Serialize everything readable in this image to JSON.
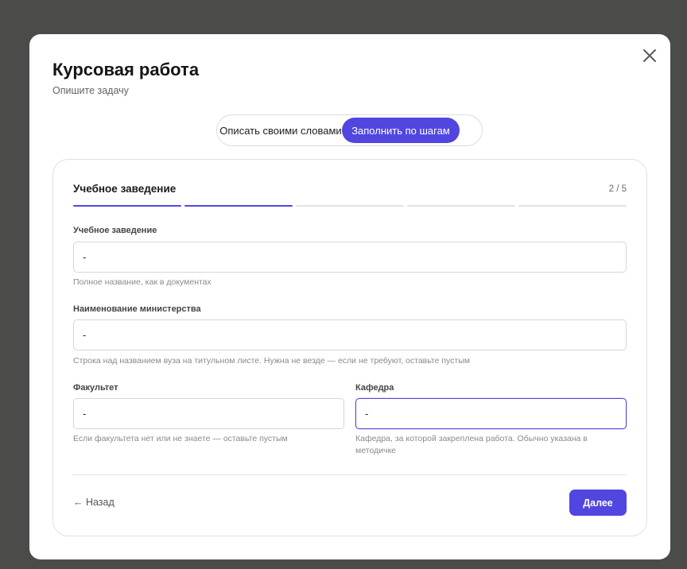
{
  "modal": {
    "title": "Курсовая работа",
    "subtitle": "Опишите задачу",
    "close_icon": "close-icon"
  },
  "mode_switch": {
    "options": [
      "Описать своими словами",
      "Заполнить по шагам"
    ],
    "selected": "Заполнить по шагам"
  },
  "step": {
    "title": "Учебное заведение",
    "counter": "2 / 5",
    "current": 2,
    "total": 5
  },
  "fields": {
    "institution": {
      "label": "Учебное заведение",
      "value": "-",
      "hint": "Полное название, как в документах"
    },
    "ministry": {
      "label": "Наименование министерства",
      "value": "-",
      "hint": "Строка над названием вуза на титульном листе. Нужна не везде — если не требуют, оставьте пустым"
    },
    "faculty": {
      "label": "Факультет",
      "value": "-",
      "hint": "Если факультета нет или не знаете — оставьте пустым"
    },
    "department": {
      "label": "Кафедра",
      "value": "-",
      "hint": "Кафедра, за которой закреплена работа. Обычно указана в методичке"
    }
  },
  "actions": {
    "back": "← Назад",
    "next": "Далее"
  },
  "colors": {
    "accent": "#5246e0",
    "overlay": "#4b4c4a"
  }
}
